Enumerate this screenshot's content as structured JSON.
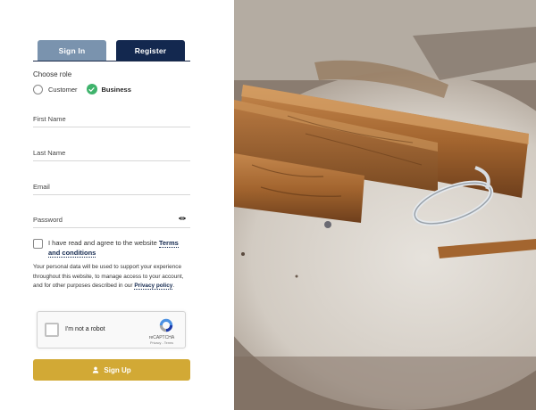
{
  "tabs": {
    "sign_in": "Sign In",
    "register": "Register"
  },
  "role": {
    "heading": "Choose role",
    "options": [
      "Customer",
      "Business"
    ],
    "selected": "Business"
  },
  "fields": {
    "first_name": {
      "placeholder": "First Name",
      "value": ""
    },
    "last_name": {
      "placeholder": "Last Name",
      "value": ""
    },
    "email": {
      "placeholder": "Email",
      "value": ""
    },
    "password": {
      "placeholder": "Password",
      "value": ""
    }
  },
  "agree": {
    "text": "I have read and agree to the website ",
    "link": "Terms and conditions"
  },
  "privacy": {
    "text": "Your personal data will be used to support your experience throughout this website, to manage access to your account, and for other purposes described in our ",
    "link": "Privacy policy",
    "end": "."
  },
  "captcha": {
    "label": "I'm not a robot",
    "brand": "reCAPTCHA",
    "terms": "Privacy - Terms"
  },
  "signup": {
    "label": "Sign Up"
  },
  "colors": {
    "navy": "#13284f",
    "tab_inactive": "#7a93ae",
    "accent": "#d2a935",
    "check": "#3fb36c"
  },
  "icons": {
    "eye": "eye-icon",
    "user": "user-icon",
    "recaptcha": "recaptcha-icon",
    "check": "check-icon"
  }
}
